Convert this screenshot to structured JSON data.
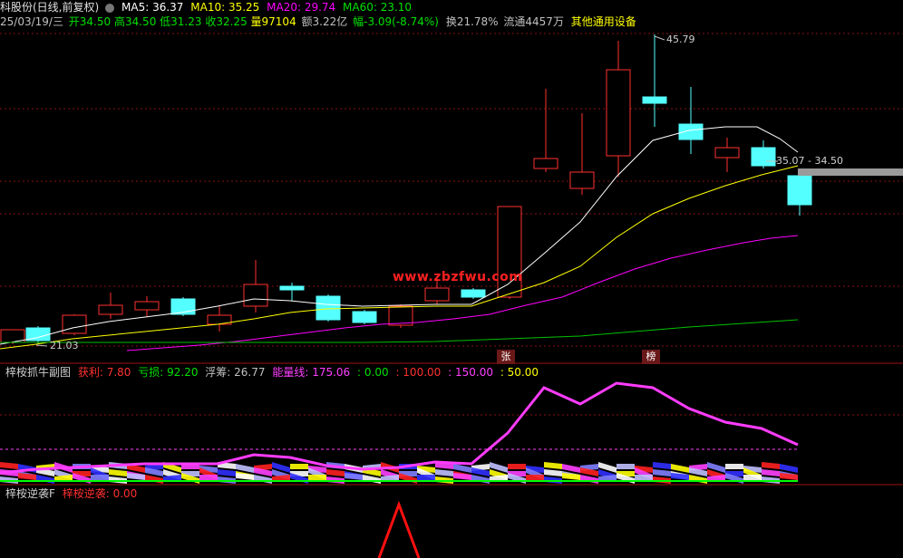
{
  "header": {
    "stock_title": "科股份(日线,前复权)",
    "ma5": "MA5: 36.37",
    "ma10": "MA10: 35.25",
    "ma20": "MA20: 29.74",
    "ma60": "MA60: 23.10",
    "date": "25/03/19/三",
    "open": "开34.50",
    "high": "高34.50",
    "low": "低31.23",
    "close": "收32.25",
    "volume": "量97104",
    "amount": "额3.22亿",
    "change": "幅-3.09(-8.74%)",
    "turnover": "换21.78%",
    "float": "流通4457万",
    "sector": "其他通用设备"
  },
  "price_panel": {
    "high_label": "45.79",
    "low_label": "21.03",
    "range_label": "35.07 - 34.50",
    "tag_zhang": "张",
    "tag_bang": "榜",
    "watermark": "www.zbzfwu.com"
  },
  "sub1": {
    "title": "梓桉抓牛副图",
    "profit": "获利: 7.80",
    "loss": "亏损: 92.20",
    "float_chip": "浮筹: 26.77",
    "energy": "能量线: 175.06",
    "l0": ": 0.00",
    "l100": ": 100.00",
    "l150": ": 150.00",
    "l50": ": 50.00"
  },
  "sub2": {
    "title": "梓桉逆袭F",
    "value": "梓桉逆袭: 0.00"
  },
  "colors": {
    "bg": "#000000",
    "up": "#ff3030",
    "down": "#54ffff",
    "ma5": "#ffffff",
    "ma10": "#ffff00",
    "ma20": "#ff00ff",
    "ma60": "#00c000"
  }
}
